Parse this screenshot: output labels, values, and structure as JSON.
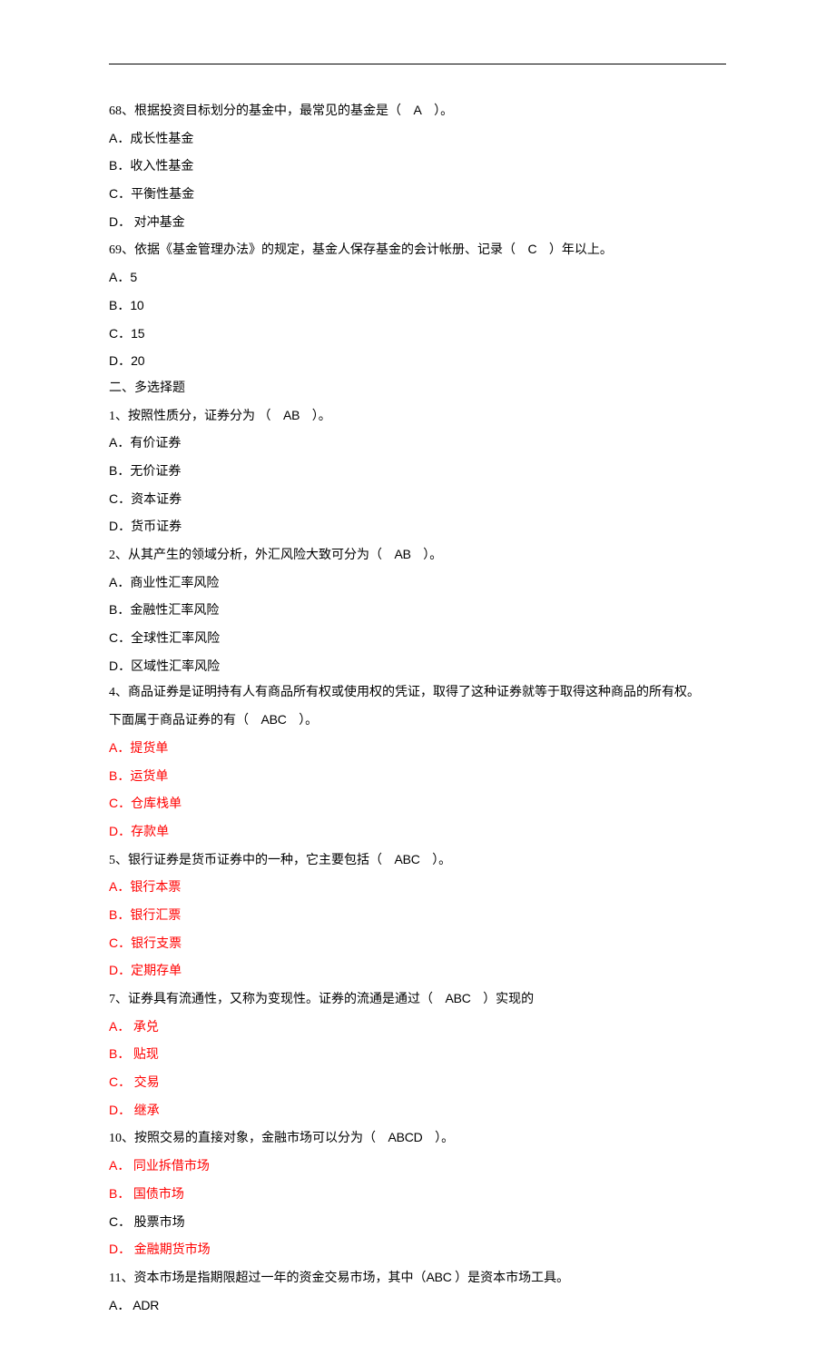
{
  "q68": {
    "stem_pre": "68、根据投资目标划分的基金中，最常见的基金是（",
    "answer": "A",
    "stem_post": "）。",
    "options": [
      {
        "label": "A．",
        "text": "成长性基金"
      },
      {
        "label": "B．",
        "text": "收入性基金"
      },
      {
        "label": "C．",
        "text": "平衡性基金"
      },
      {
        "label": "D．",
        "text": " 对冲基金"
      }
    ]
  },
  "q69": {
    "stem_pre": "69、依据《基金管理办法》的规定，基金人保存基金的会计帐册、记录（",
    "answer": "C",
    "stem_post": "）年以上。",
    "options": [
      {
        "label": "A．",
        "text": "5"
      },
      {
        "label": "B．",
        "text": "10"
      },
      {
        "label": "C．",
        "text": "15"
      },
      {
        "label": "D．",
        "text": "20"
      }
    ]
  },
  "section2_title": " 二、多选择题",
  "m1": {
    "stem_pre": "1、按照性质分，证券分为 （",
    "answer": "AB",
    "stem_post": "）。",
    "options": [
      {
        "label": "A．",
        "text": "有价证券"
      },
      {
        "label": "B．",
        "text": "无价证券"
      },
      {
        "label": "C．",
        "text": "资本证券"
      },
      {
        "label": "D．",
        "text": "货币证券"
      }
    ]
  },
  "m2": {
    "stem_pre": "2、从其产生的领域分析，外汇风险大致可分为（",
    "answer": "AB",
    "stem_post": "）。",
    "options": [
      {
        "label": "A．",
        "text": "商业性汇率风险"
      },
      {
        "label": "B．",
        "text": "金融性汇率风险"
      },
      {
        "label": "C．",
        "text": "全球性汇率风险"
      },
      {
        "label": "D．",
        "text": "区域性汇率风险"
      }
    ]
  },
  "m4": {
    "stem_line1": "4、商品证券是证明持有人有商品所有权或使用权的凭证，取得了这种证券就等于取得这种商品的所有权。",
    "stem_pre": "下面属于商品证券的有（",
    "answer": "ABC",
    "stem_post": "）。",
    "options": [
      {
        "label": "A．",
        "text": "提货单",
        "red": true
      },
      {
        "label": "B．",
        "text": "运货单",
        "red": true
      },
      {
        "label": "C．",
        "text": "仓库栈单",
        "red": true
      },
      {
        "label": "D．",
        "text": "存款单",
        "red": true
      }
    ]
  },
  "m5": {
    "stem_pre": "5、银行证券是货币证券中的一种，它主要包括（",
    "answer": "ABC",
    "stem_post": "）。",
    "options": [
      {
        "label": "A．",
        "text": "银行本票",
        "red": true
      },
      {
        "label": "B．",
        "text": "银行汇票",
        "red": true
      },
      {
        "label": "C．",
        "text": "银行支票",
        "red": true
      },
      {
        "label": "D．",
        "text": "定期存单",
        "red": true
      }
    ]
  },
  "m7": {
    "stem_pre": "7、证券具有流通性，又称为变现性。证券的流通是通过（",
    "answer": "ABC",
    "stem_post": "）实现的",
    "options": [
      {
        "label": "A．",
        "text": "  承兑",
        "red": true
      },
      {
        "label": "B．",
        "text": "  贴现",
        "red": true
      },
      {
        "label": "C．",
        "text": "  交易",
        "red": true
      },
      {
        "label": "D．",
        "text": "  继承",
        "red": true
      }
    ]
  },
  "m10": {
    "stem_pre": "10、按照交易的直接对象，金融市场可以分为（",
    "answer": "ABCD",
    "stem_post": "）。",
    "options": [
      {
        "label": "A．",
        "text": "  同业拆借市场",
        "red": true
      },
      {
        "label": "B．",
        "text": "  国债市场",
        "red": true
      },
      {
        "label": "C．",
        "text": "  股票市场",
        "red": false
      },
      {
        "label": "D．",
        "text": "  金融期货市场",
        "red": true
      }
    ]
  },
  "m11": {
    "stem_pre": "11、资本市场是指期限超过一年的资金交易市场，其中（",
    "answer": "ABC",
    "stem_post": "  ）是资本市场工具。",
    "options": [
      {
        "label": "A．",
        "text": "  ADR"
      }
    ]
  }
}
